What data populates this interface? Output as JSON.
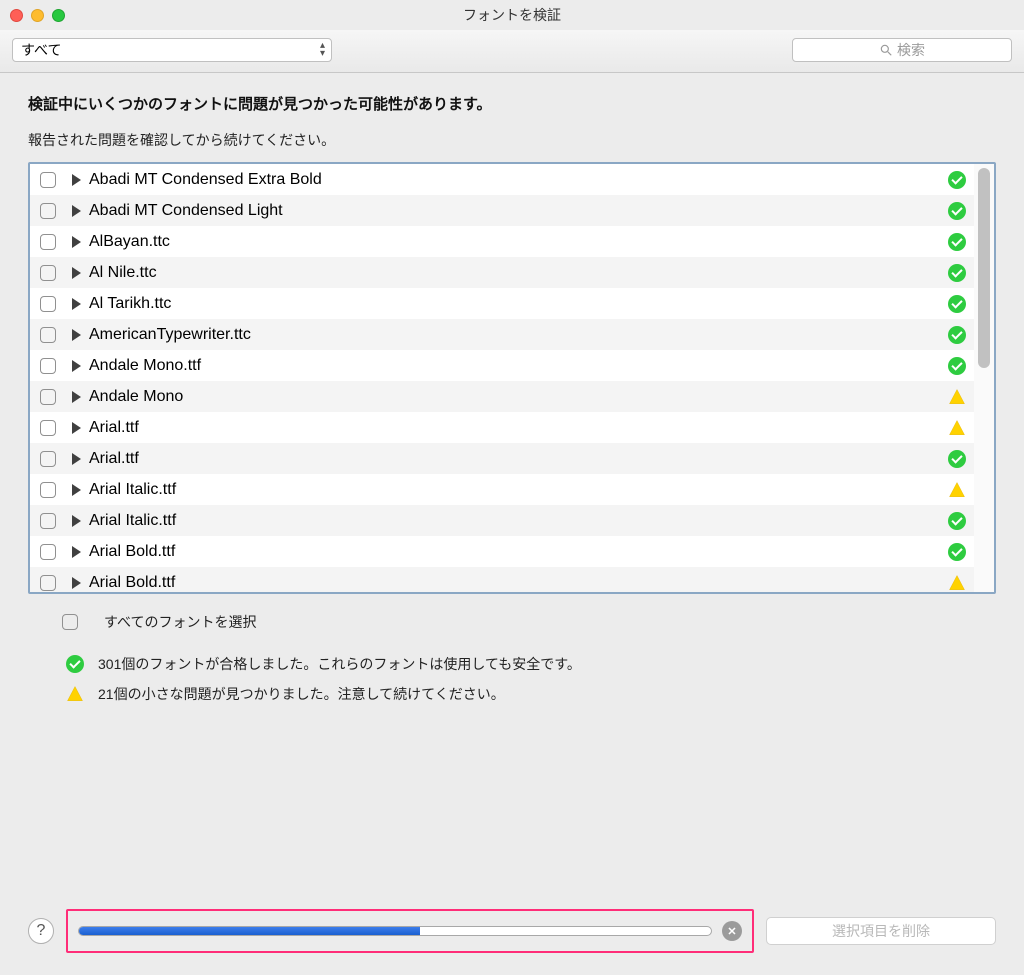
{
  "window": {
    "title": "フォントを検証"
  },
  "toolbar": {
    "filter_selected": "すべて",
    "search_placeholder": "検索"
  },
  "messages": {
    "heading": "検証中にいくつかのフォントに問題が見つかった可能性があります。",
    "subheading": "報告された問題を確認してから続けてください。",
    "select_all": "すべてのフォントを選択",
    "passed": "301個のフォントが合格しました。これらのフォントは使用しても安全です。",
    "warnings": "21個の小さな問題が見つかりました。注意して続けてください。"
  },
  "fonts": [
    {
      "name": "Abadi MT Condensed Extra Bold",
      "status": "ok"
    },
    {
      "name": "Abadi MT Condensed Light",
      "status": "ok"
    },
    {
      "name": "AlBayan.ttc",
      "status": "ok"
    },
    {
      "name": "Al Nile.ttc",
      "status": "ok"
    },
    {
      "name": "Al Tarikh.ttc",
      "status": "ok"
    },
    {
      "name": "AmericanTypewriter.ttc",
      "status": "ok"
    },
    {
      "name": "Andale Mono.ttf",
      "status": "ok"
    },
    {
      "name": "Andale Mono",
      "status": "warn"
    },
    {
      "name": "Arial.ttf",
      "status": "warn"
    },
    {
      "name": "Arial.ttf",
      "status": "ok"
    },
    {
      "name": "Arial Italic.ttf",
      "status": "warn"
    },
    {
      "name": "Arial Italic.ttf",
      "status": "ok"
    },
    {
      "name": "Arial Bold.ttf",
      "status": "ok"
    },
    {
      "name": "Arial Bold.ttf",
      "status": "warn"
    }
  ],
  "progress": {
    "percent": 54
  },
  "footer": {
    "delete_label": "選択項目を削除"
  }
}
